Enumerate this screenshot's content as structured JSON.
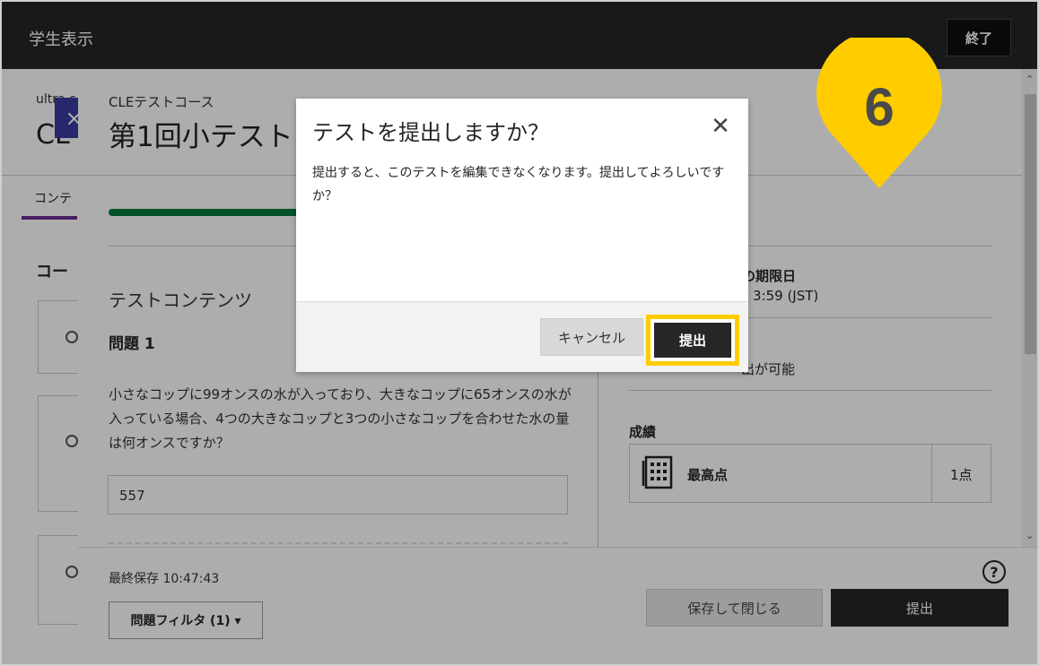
{
  "topbar": {
    "title": "学生表示",
    "end_button": "終了"
  },
  "background_page": {
    "course_small": "ultra c",
    "course_big": "CL",
    "tab_label": "コンテ",
    "section_label": "コー",
    "close_label": "×"
  },
  "panel": {
    "course_name": "CLEテストコース",
    "test_title": "第1回小テスト",
    "content_heading": "テストコンテンツ",
    "question_heading": "問題 1",
    "question_text": "小さなコップに99オンスの水が入っており、大きなコップに65オンスの水が入っている場合、4つの大きなコップと3つの小さなコップを合わせた水の量は何オンスですか？",
    "answer_value": "557",
    "due_title": "の期限日",
    "due_value": "3:59 (JST)",
    "attempts_text": "出が可能",
    "grade_heading": "成績",
    "grade_label": "最高点",
    "grade_value": "1点",
    "progress_fraction": 0.43,
    "scroll_up": "⌃",
    "scroll_down": "⌄"
  },
  "footer": {
    "last_saved": "最終保存 10:47:43",
    "filter_label": "問題フィルタ (1) ▾",
    "help_label": "?",
    "save_close_label": "保存して閉じる",
    "submit_label": "提出"
  },
  "dialog": {
    "title": "テストを提出しますか？",
    "close_label": "✕",
    "body": "提出すると、このテストを編集できなくなります。提出してよろしいですか？",
    "cancel_label": "キャンセル",
    "submit_label": "提出"
  },
  "marker": {
    "number": "6",
    "color": "#ffcc00"
  },
  "colors": {
    "topbar": "#262626",
    "progress": "#007a3d",
    "highlight": "#ffcc00",
    "accent_tab": "#6a2c91"
  }
}
